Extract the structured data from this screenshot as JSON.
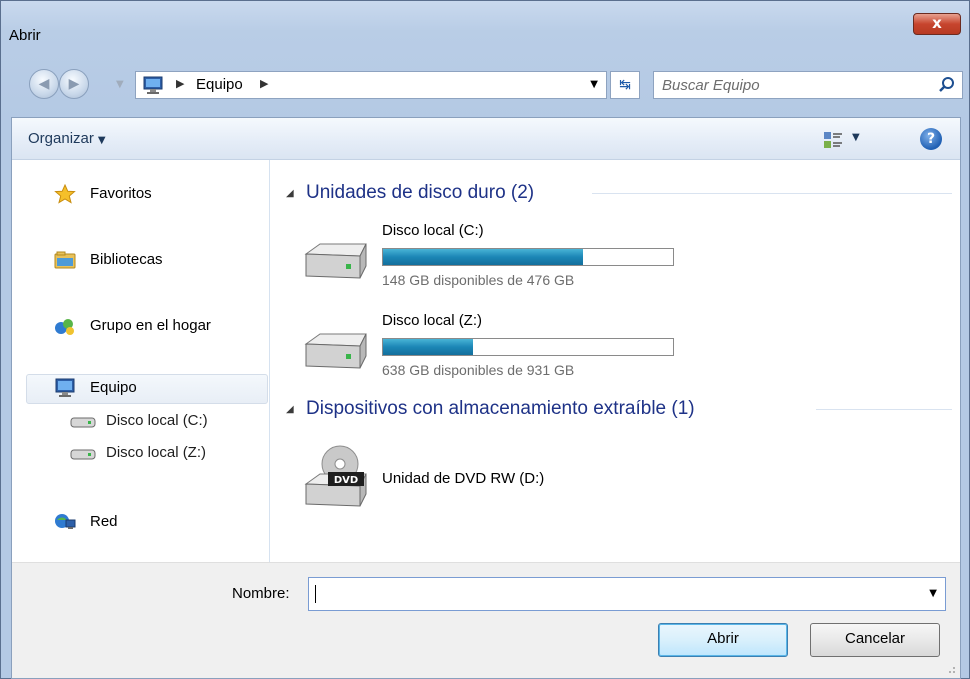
{
  "window": {
    "title": "Abrir",
    "close_label": "x"
  },
  "nav": {
    "back_label": "◀",
    "forward_label": "▶",
    "address": {
      "breadcrumb": [
        "Equipo"
      ]
    },
    "search": {
      "placeholder": "Buscar Equipo"
    }
  },
  "toolbar": {
    "organize_label": "Organizar",
    "help_label": "?"
  },
  "sidebar": {
    "items": [
      {
        "label": "Favoritos",
        "icon": "star-icon"
      },
      {
        "label": "Bibliotecas",
        "icon": "libraries-icon"
      },
      {
        "label": "Grupo en el hogar",
        "icon": "homegroup-icon"
      },
      {
        "label": "Equipo",
        "icon": "computer-icon",
        "selected": true
      },
      {
        "label": "Red",
        "icon": "network-icon"
      }
    ],
    "sub_items": [
      {
        "label": "Disco local (C:)",
        "icon": "drive-icon"
      },
      {
        "label": "Disco local (Z:)",
        "icon": "drive-icon"
      }
    ]
  },
  "main": {
    "groups": [
      {
        "title": "Unidades de disco duro (2)",
        "drives": [
          {
            "name": "Disco local (C:)",
            "free_text": "148 GB disponibles de 476 GB",
            "used_fraction": 0.69
          },
          {
            "name": "Disco local (Z:)",
            "free_text": "638 GB disponibles de 931 GB",
            "used_fraction": 0.31
          }
        ]
      },
      {
        "title": "Dispositivos con almacenamiento extraíble (1)",
        "devices": [
          {
            "name": "Unidad de DVD RW (D:)",
            "icon": "dvd-drive-icon",
            "badge": "DVD"
          }
        ]
      }
    ]
  },
  "bottom": {
    "filename_label": "Nombre:",
    "filename_value": "",
    "open_label": "Abrir",
    "cancel_label": "Cancelar"
  },
  "colors": {
    "accent": "#1e3287",
    "progress": "#1c86b6",
    "close": "#c7452e"
  }
}
